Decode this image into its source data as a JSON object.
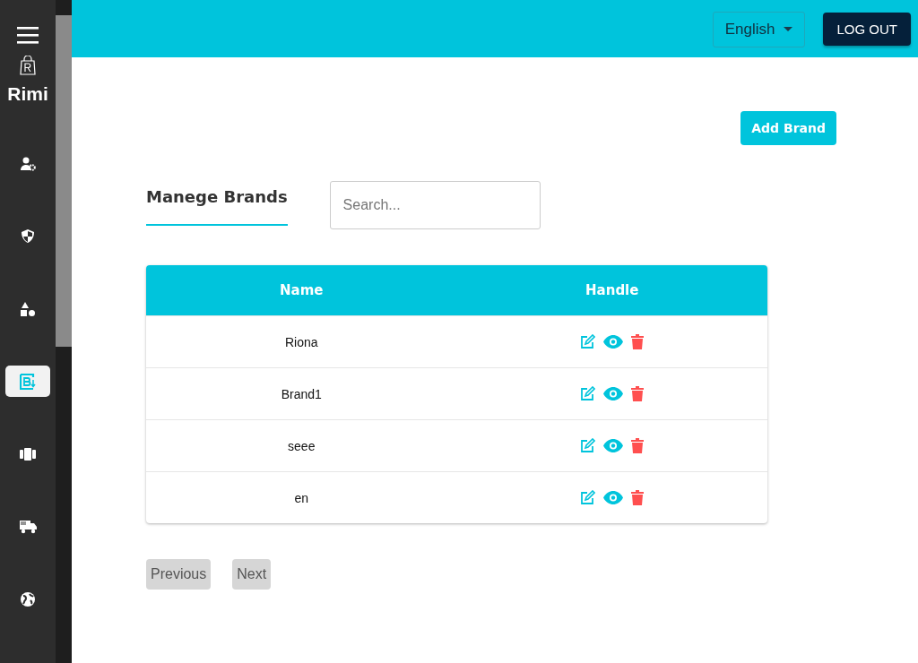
{
  "sidebar": {
    "brand": "Rimi",
    "items": [
      {
        "kind": "users",
        "selected": false
      },
      {
        "kind": "shield",
        "selected": false
      },
      {
        "kind": "shapes",
        "selected": false
      },
      {
        "kind": "brand",
        "selected": true
      },
      {
        "kind": "box",
        "selected": false
      },
      {
        "kind": "truck",
        "selected": false
      },
      {
        "kind": "globe",
        "selected": false
      }
    ]
  },
  "topbar": {
    "language": "English",
    "logout": "LOG OUT"
  },
  "add_button": "Add Brand",
  "title": "Manege Brands",
  "search": {
    "placeholder": "Search..."
  },
  "table": {
    "columns": [
      "Name",
      "Handle"
    ],
    "rows": [
      {
        "name": "Riona"
      },
      {
        "name": "Brand1"
      },
      {
        "name": "seee"
      },
      {
        "name": "en"
      }
    ]
  },
  "pagination": {
    "previous": "Previous",
    "next": "Next"
  }
}
